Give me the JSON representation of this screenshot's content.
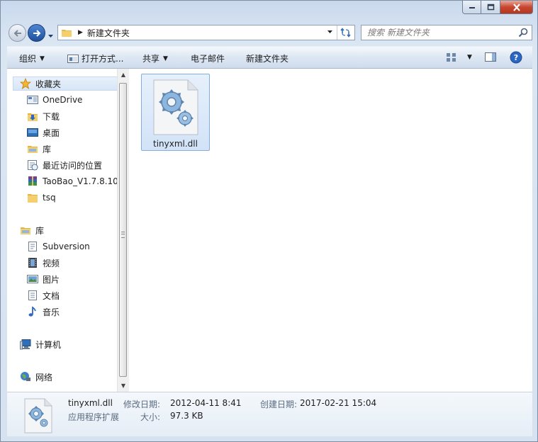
{
  "window": {
    "caption_buttons": {
      "minimize": "minimize",
      "maximize": "maximize",
      "close": "close"
    }
  },
  "address": {
    "crumb": "新建文件夹"
  },
  "search": {
    "placeholder": "搜索 新建文件夹"
  },
  "toolbar": {
    "organize": "组织",
    "open_with": "打开方式...",
    "share": "共享",
    "email": "电子邮件",
    "new_folder": "新建文件夹"
  },
  "sidebar": {
    "favorites": {
      "header": "收藏夹",
      "items": [
        {
          "label": "OneDrive",
          "icon": "onedrive-icon"
        },
        {
          "label": "下载",
          "icon": "downloads-folder-icon"
        },
        {
          "label": "桌面",
          "icon": "desktop-icon"
        },
        {
          "label": "库",
          "icon": "library-icon"
        },
        {
          "label": "最近访问的位置",
          "icon": "recent-places-icon"
        },
        {
          "label": "TaoBao_V1.7.8.10_",
          "icon": "winrar-archive-icon"
        },
        {
          "label": "tsq",
          "icon": "folder-icon"
        }
      ]
    },
    "libraries": {
      "header": "库",
      "items": [
        {
          "label": "Subversion",
          "icon": "subversion-icon"
        },
        {
          "label": "视频",
          "icon": "video-icon"
        },
        {
          "label": "图片",
          "icon": "pictures-icon"
        },
        {
          "label": "文档",
          "icon": "documents-icon"
        },
        {
          "label": "音乐",
          "icon": "music-icon"
        }
      ]
    },
    "computer": {
      "header": "计算机"
    },
    "network": {
      "header": "网络"
    }
  },
  "content": {
    "files": [
      {
        "name": "tinyxml.dll",
        "icon": "dll-gear-icon"
      }
    ]
  },
  "details": {
    "name": "tinyxml.dll",
    "type": "应用程序扩展",
    "modified_label": "修改日期:",
    "modified_value": "2012-04-11 8:41",
    "created_label": "创建日期:",
    "created_value": "2017-02-21 15:04",
    "size_label": "大小:",
    "size_value": "97.3 KB"
  }
}
